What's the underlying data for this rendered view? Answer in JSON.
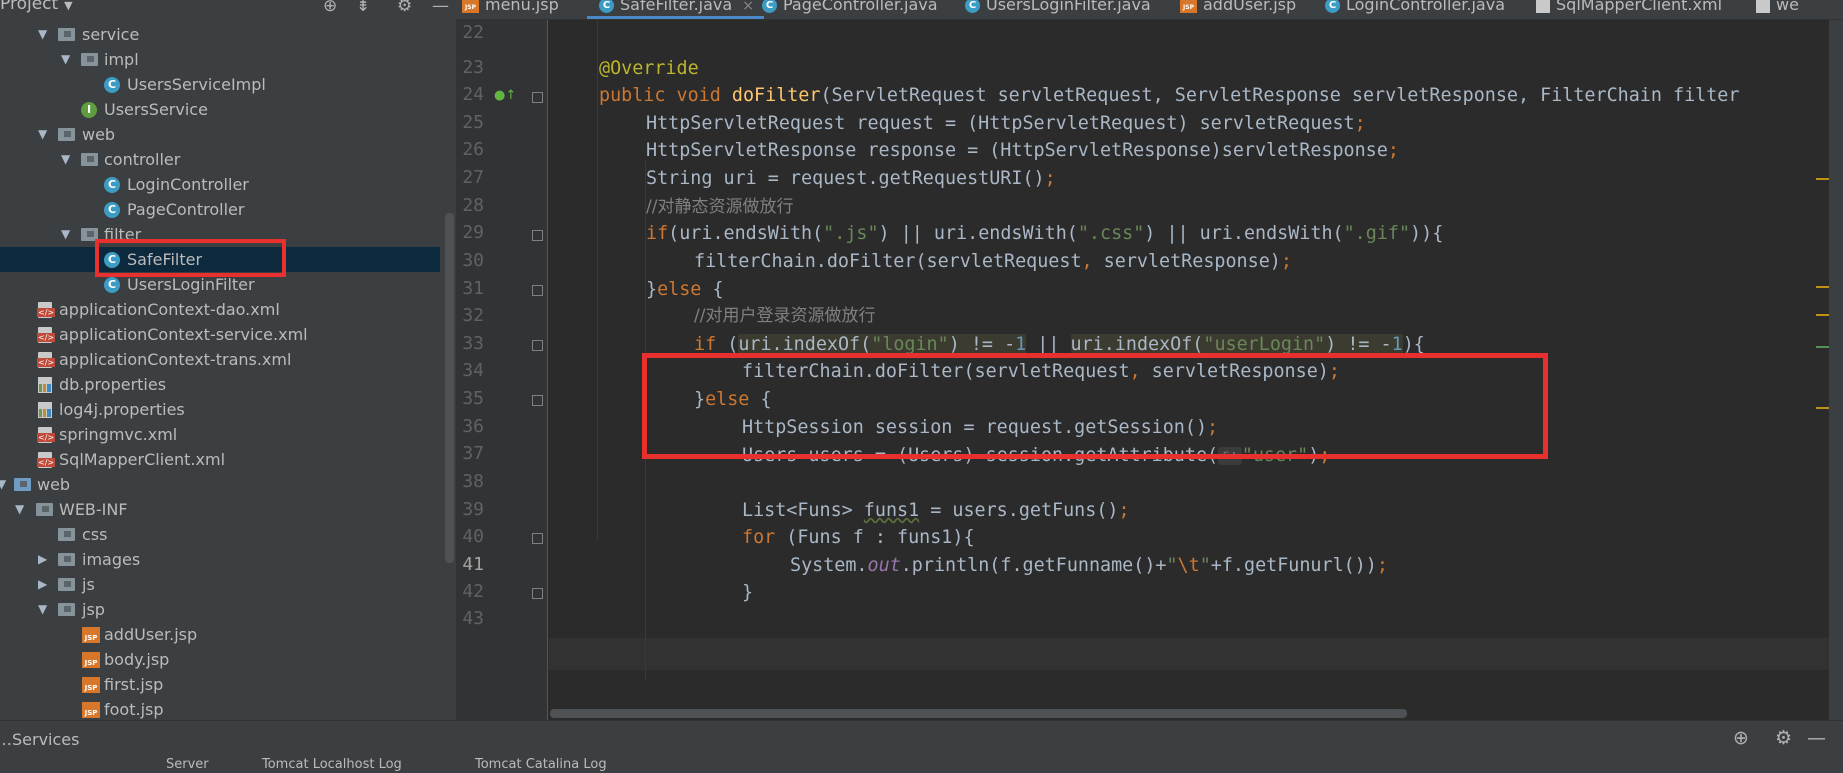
{
  "project_panel": {
    "title": "Project",
    "tree": [
      {
        "label": "service",
        "icon": "folder",
        "indent": 1,
        "expanded": true
      },
      {
        "label": "impl",
        "icon": "folder",
        "indent": 2,
        "expanded": true
      },
      {
        "label": "UsersServiceImpl",
        "icon": "class",
        "indent": 3
      },
      {
        "label": "UsersService",
        "icon": "interface",
        "indent": 2
      },
      {
        "label": "web",
        "icon": "folder",
        "indent": 1,
        "expanded": true
      },
      {
        "label": "controller",
        "icon": "folder",
        "indent": 2,
        "expanded": true
      },
      {
        "label": "LoginController",
        "icon": "class",
        "indent": 3
      },
      {
        "label": "PageController",
        "icon": "class",
        "indent": 3
      },
      {
        "label": "filter",
        "icon": "folder",
        "indent": 2,
        "expanded": true
      },
      {
        "label": "SafeFilter",
        "icon": "class",
        "indent": 3,
        "selected": true
      },
      {
        "label": "UsersLoginFilter",
        "icon": "class",
        "indent": 3
      },
      {
        "label": "applicationContext-dao.xml",
        "icon": "xml",
        "indent": 0
      },
      {
        "label": "applicationContext-service.xml",
        "icon": "xml",
        "indent": 0
      },
      {
        "label": "applicationContext-trans.xml",
        "icon": "xml",
        "indent": 0
      },
      {
        "label": "db.properties",
        "icon": "properties",
        "indent": 0
      },
      {
        "label": "log4j.properties",
        "icon": "properties",
        "indent": 0
      },
      {
        "label": "springmvc.xml",
        "icon": "xml",
        "indent": 0
      },
      {
        "label": "SqlMapperClient.xml",
        "icon": "xml",
        "indent": 0
      },
      {
        "label": "web",
        "icon": "folder-blue",
        "indent": -1,
        "expanded": true
      },
      {
        "label": "WEB-INF",
        "icon": "folder",
        "indent": 0,
        "expanded": true
      },
      {
        "label": "css",
        "icon": "folder",
        "indent": 1
      },
      {
        "label": "images",
        "icon": "folder",
        "indent": 1,
        "expanded": false
      },
      {
        "label": "js",
        "icon": "folder",
        "indent": 1,
        "expanded": false
      },
      {
        "label": "jsp",
        "icon": "folder",
        "indent": 1,
        "expanded": true
      },
      {
        "label": "addUser.jsp",
        "icon": "jsp",
        "indent": 2
      },
      {
        "label": "body.jsp",
        "icon": "jsp",
        "indent": 2
      },
      {
        "label": "first.jsp",
        "icon": "jsp",
        "indent": 2
      },
      {
        "label": "foot.jsp",
        "icon": "jsp",
        "indent": 2
      }
    ]
  },
  "editor_tabs": [
    {
      "label": "menu.jsp",
      "icon": "jsp"
    },
    {
      "label": "SafeFilter.java",
      "icon": "class",
      "active": true
    },
    {
      "label": "PageController.java",
      "icon": "class"
    },
    {
      "label": "UsersLoginFilter.java",
      "icon": "class"
    },
    {
      "label": "addUser.jsp",
      "icon": "jsp"
    },
    {
      "label": "LoginController.java",
      "icon": "class"
    },
    {
      "label": "SqlMapperClient.xml",
      "icon": "xml"
    },
    {
      "label": "we",
      "icon": "xml"
    }
  ],
  "line_numbers": [
    "22",
    "23",
    "24",
    "25",
    "26",
    "27",
    "28",
    "29",
    "30",
    "31",
    "32",
    "33",
    "34",
    "35",
    "36",
    "37",
    "38",
    "39",
    "40",
    "41",
    "42",
    "43"
  ],
  "current_line": "41",
  "code": {
    "override": "@Override",
    "l24_kw": "public void ",
    "l24_fn": "doFilter",
    "l24_rest": "(ServletRequest servletRequest, ServletResponse servletResponse, FilterChain filter",
    "l25": "HttpServletRequest request = (HttpServletRequest) servletRequest",
    "l26": "HttpServletResponse response = (HttpServletResponse)servletResponse",
    "l27": "String uri = request.getRequestURI()",
    "l28": "//对静态资源做放行",
    "l29_kw": "if",
    "l29_a": "(uri.endsWith(",
    "l29_s1": "\".js\"",
    "l29_b": ") || uri.endsWith(",
    "l29_s2": "\".css\"",
    "l29_c": ") || uri.endsWith(",
    "l29_s3": "\".gif\"",
    "l29_d": ")){",
    "l30": "filterChain.doFilter(servletRequest",
    "l30_b": " servletResponse)",
    "l31_a": "}",
    "l31_kw": "else",
    "l31_b": " {",
    "l32": "//对用户登录资源做放行",
    "l33_kw": "if",
    "l33_a": "uri.indexOf(",
    "l33_s1": "\"login\"",
    "l33_b": ") != -",
    "l33_n1": "1",
    "l33_c": "uri.indexOf(",
    "l33_s2": "\"userLogin\"",
    "l33_d": ") != -",
    "l33_n2": "1",
    "l34": "filterChain.doFilter(servletRequest",
    "l34_b": " servletResponse)",
    "l35_a": "}",
    "l35_kw": "else",
    "l35_b": " {",
    "l36": "HttpSession session = request.getSession()",
    "l37_a": "Users users = (Users) session.getAttribute(",
    "l37_hint": "s:",
    "l37_s": "\"user\"",
    "l37_b": ")",
    "l39_a": "List<Funs> ",
    "l39_b": "funs1",
    "l39_c": " = users.getFuns()",
    "l40_kw": "for",
    "l40_a": " (Funs f : funs1){",
    "l41_a": "System.",
    "l41_it": "out",
    "l41_b": ".println(f.getFunname()+",
    "l41_s1": "\"",
    "l41_esc": "\\t",
    "l41_s2": "\"",
    "l41_c": "+f.getFunurl())",
    "l42": "}"
  },
  "bottom_panel": {
    "title": "Services",
    "tabs": [
      "Server",
      "Tomcat Localhost Log",
      "Tomcat Catalina Log"
    ]
  },
  "highlight_color": "#e8302f",
  "accent_color": "#4a88c7"
}
